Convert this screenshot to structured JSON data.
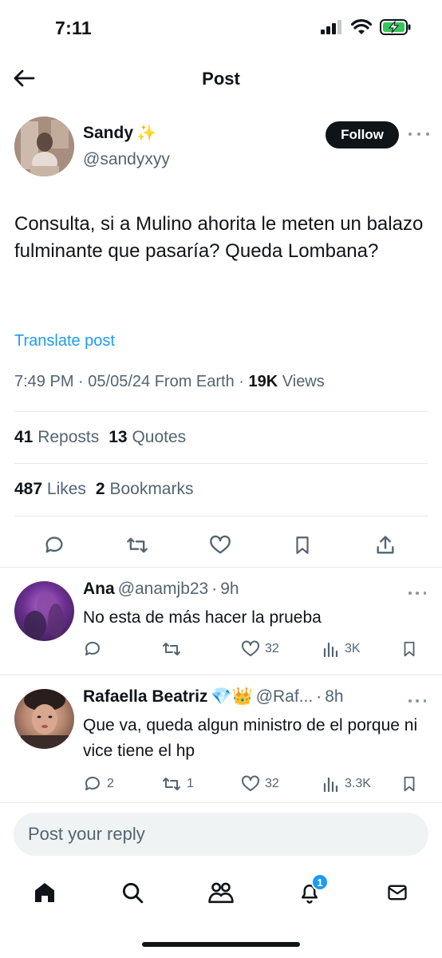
{
  "status_bar": {
    "time": "7:11"
  },
  "top_bar": {
    "title": "Post"
  },
  "post": {
    "author": {
      "name": "Sandy",
      "name_emoji": "✨",
      "handle": "@sandyxyy"
    },
    "follow_label": "Follow",
    "text": "Consulta, si a Mulino ahorita le meten un balazo fulminante que pasaría? Queda Lombana?",
    "translate_label": "Translate post",
    "time": "7:49 PM",
    "date": "05/05/24",
    "source": "From Earth",
    "views_count": "19K",
    "views_label": "Views",
    "reposts_count": "41",
    "reposts_label": "Reposts",
    "quotes_count": "13",
    "quotes_label": "Quotes",
    "likes_count": "487",
    "likes_label": "Likes",
    "bookmarks_count": "2",
    "bookmarks_label": "Bookmarks"
  },
  "replies": [
    {
      "name": "Ana",
      "handle": "@anamjb23",
      "time": "9h",
      "text": "No esta de más hacer la prueba",
      "reply_count": "",
      "repost_count": "",
      "like_count": "32",
      "view_count": "3K"
    },
    {
      "name": "Rafaella Beatriz",
      "badges": "💎👑",
      "handle": "@Raf...",
      "time": "8h",
      "text": "Que va, queda algun ministro de el porque ni vice tiene el hp",
      "reply_count": "2",
      "repost_count": "1",
      "like_count": "32",
      "view_count": "3.3K"
    }
  ],
  "reply_box": {
    "placeholder": "Post your reply"
  },
  "tab_bar": {
    "notifications_badge": "1"
  },
  "colors": {
    "accent": "#1d9bf0",
    "text": "#0f1419",
    "muted": "#536471",
    "divider": "#e6e9ec"
  },
  "icons": [
    "back-arrow-icon",
    "signal-icon",
    "wifi-icon",
    "battery-charging-icon",
    "reply-icon",
    "repost-icon",
    "like-icon",
    "bookmark-icon",
    "share-icon",
    "views-icon",
    "home-icon",
    "search-icon",
    "communities-icon",
    "notifications-icon",
    "messages-icon"
  ]
}
